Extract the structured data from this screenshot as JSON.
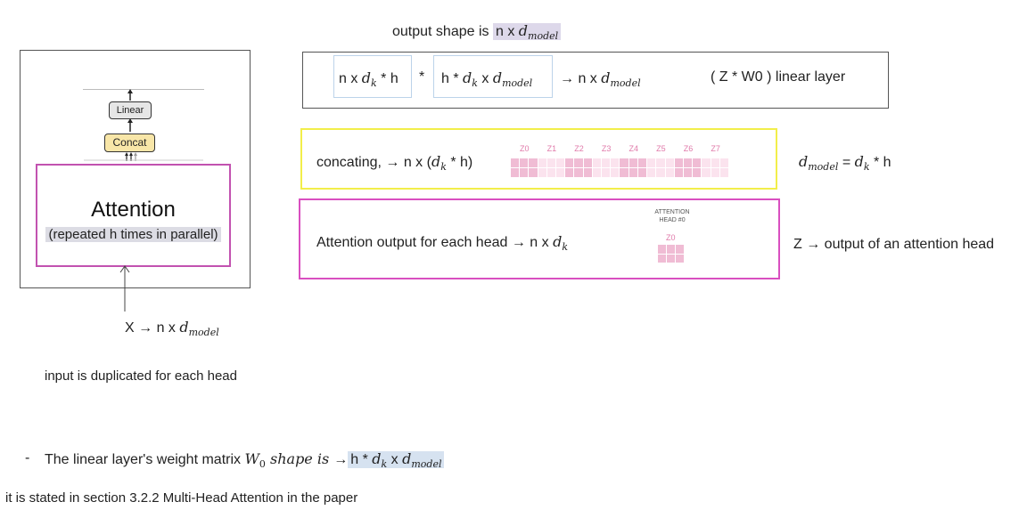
{
  "top_note": {
    "prefix": "output shape is",
    "value_plain": "n x ",
    "value_var": "d",
    "value_sub": "model"
  },
  "linear_box": {
    "term1": {
      "a": "n x ",
      "var": "d",
      "sub": "k",
      "b": " * h"
    },
    "times": "*",
    "term2": {
      "a": "h * ",
      "var": "d",
      "sub": "k",
      "b": " x ",
      "var2": "d",
      "sub2": "model"
    },
    "arrow": "→",
    "result": {
      "a": "n x ",
      "var": "d",
      "sub": "model"
    },
    "label": "( Z * W0 ) linear layer"
  },
  "concat_box": {
    "label_a": "concating, → n x (",
    "var": "d",
    "sub": "k",
    "label_b": " * h)",
    "z_labels": [
      "Z0",
      "Z1",
      "Z2",
      "Z3",
      "Z4",
      "Z5",
      "Z6",
      "Z7"
    ]
  },
  "dmodel_eq": {
    "var": "d",
    "sub": "model",
    "eq": " = ",
    "var2": "d",
    "sub2": "k",
    "tail": " * h"
  },
  "head_box": {
    "label_a": "Attention output for each head → n x ",
    "var": "d",
    "sub": "k",
    "title_line1": "ATTENTION",
    "title_line2": "HEAD #0",
    "z_label": "Z0"
  },
  "z_note": "Z → output of an attention head",
  "diagram": {
    "linear": "Linear",
    "concat": "Concat",
    "attention": "Attention",
    "repeated": "(repeated h times in parallel)"
  },
  "x_label": {
    "a": "X → n x ",
    "var": "d",
    "sub": "model"
  },
  "dup_note": "input is duplicated for each head",
  "bullet": {
    "dash": "-",
    "a": "The linear layer's weight matrix ",
    "w": "W",
    "w_sub": "0",
    "b": " shape is ",
    "arrow": "→",
    "c": "h * ",
    "var": "d",
    "sub": "k",
    "d": " x ",
    "var2": "d",
    "sub2": "model"
  },
  "footer": "it is stated in section 3.2.2 Multi-Head Attention in the paper",
  "colors": {
    "pink": "#d94fc0",
    "yellow": "#f2ee4a",
    "cell_dark": "#f0bcd4",
    "cell_light": "#fbe3ee",
    "border_gray": "#555555"
  }
}
